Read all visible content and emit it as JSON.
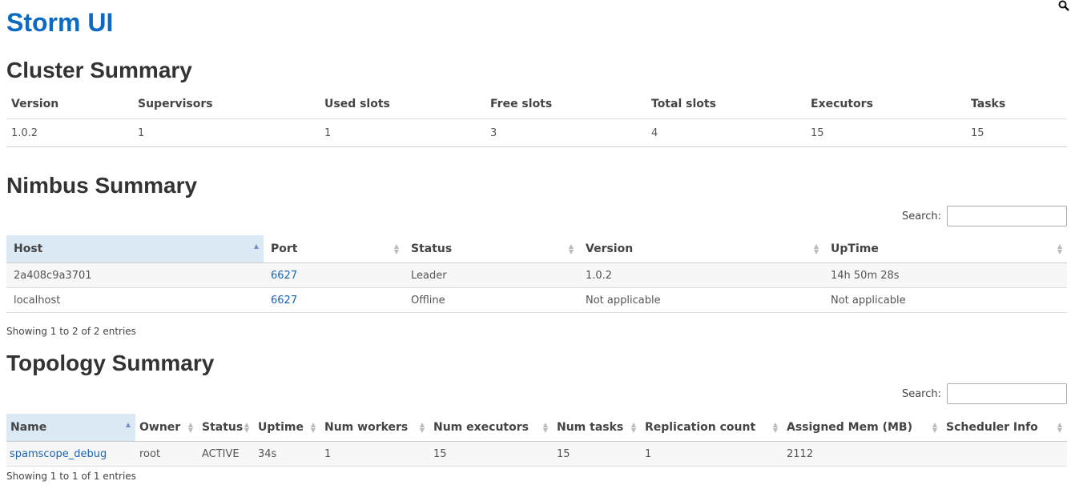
{
  "app": {
    "title": "Storm UI"
  },
  "cluster": {
    "heading": "Cluster Summary",
    "columns": [
      "Version",
      "Supervisors",
      "Used slots",
      "Free slots",
      "Total slots",
      "Executors",
      "Tasks"
    ],
    "row": [
      "1.0.2",
      "1",
      "1",
      "3",
      "4",
      "15",
      "15"
    ]
  },
  "nimbus": {
    "heading": "Nimbus Summary",
    "search_label": "Search:",
    "search_value": "",
    "columns": [
      "Host",
      "Port",
      "Status",
      "Version",
      "UpTime"
    ],
    "rows": [
      [
        "2a408c9a3701",
        "6627",
        "Leader",
        "1.0.2",
        "14h 50m 28s"
      ],
      [
        "localhost",
        "6627",
        "Offline",
        "Not applicable",
        "Not applicable"
      ]
    ],
    "info": "Showing 1 to 2 of 2 entries"
  },
  "topology": {
    "heading": "Topology Summary",
    "search_label": "Search:",
    "search_value": "",
    "columns": [
      "Name",
      "Owner",
      "Status",
      "Uptime",
      "Num workers",
      "Num executors",
      "Num tasks",
      "Replication count",
      "Assigned Mem (MB)",
      "Scheduler Info"
    ],
    "rows": [
      [
        "spamscope_debug",
        "root",
        "ACTIVE",
        "34s",
        "1",
        "15",
        "15",
        "1",
        "2112",
        ""
      ]
    ],
    "info": "Showing 1 to 1 of 1 entries"
  }
}
